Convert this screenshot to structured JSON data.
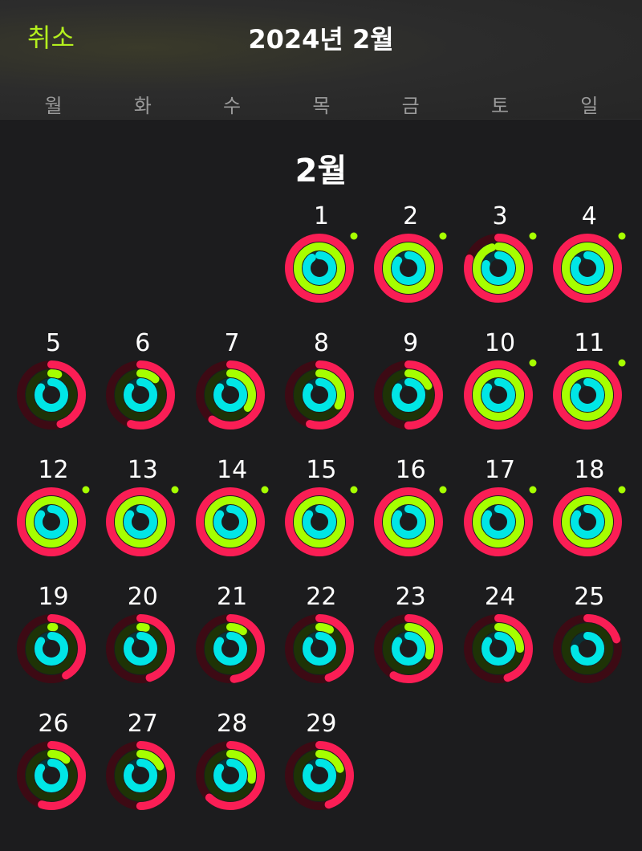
{
  "header": {
    "cancel_label": "취소",
    "title": "2024년 2월"
  },
  "weekdays": [
    "월",
    "화",
    "수",
    "목",
    "금",
    "토",
    "일"
  ],
  "month_label": "2월",
  "first_weekday_index": 3,
  "colors": {
    "accent": "#b4f01e",
    "move": "#fa1e55",
    "exercise": "#a6ff00",
    "stand": "#00e6e6",
    "goal_dot": "#a6ff00"
  },
  "days": [
    {
      "day": "1",
      "move": 1.2,
      "exercise": 1.1,
      "stand": 0.9,
      "goal": true
    },
    {
      "day": "2",
      "move": 1.15,
      "exercise": 1.1,
      "stand": 0.85,
      "goal": true
    },
    {
      "day": "3",
      "move": 0.8,
      "exercise": 0.95,
      "stand": 0.8,
      "goal": true
    },
    {
      "day": "4",
      "move": 1.3,
      "exercise": 1.2,
      "stand": 0.85,
      "goal": true
    },
    {
      "day": "5",
      "move": 0.45,
      "exercise": 0.05,
      "stand": 0.85,
      "goal": false
    },
    {
      "day": "6",
      "move": 0.55,
      "exercise": 0.12,
      "stand": 0.85,
      "goal": false
    },
    {
      "day": "7",
      "move": 0.6,
      "exercise": 0.35,
      "stand": 0.85,
      "goal": false
    },
    {
      "day": "8",
      "move": 0.55,
      "exercise": 0.33,
      "stand": 0.85,
      "goal": false
    },
    {
      "day": "9",
      "move": 0.5,
      "exercise": 0.18,
      "stand": 0.85,
      "goal": false
    },
    {
      "day": "10",
      "move": 1.1,
      "exercise": 1.1,
      "stand": 0.85,
      "goal": true
    },
    {
      "day": "11",
      "move": 1.15,
      "exercise": 1.1,
      "stand": 0.85,
      "goal": true
    },
    {
      "day": "12",
      "move": 1.3,
      "exercise": 1.2,
      "stand": 0.85,
      "goal": true
    },
    {
      "day": "13",
      "move": 1.15,
      "exercise": 1.1,
      "stand": 0.85,
      "goal": true
    },
    {
      "day": "14",
      "move": 1.1,
      "exercise": 1.05,
      "stand": 0.85,
      "goal": true
    },
    {
      "day": "15",
      "move": 1.15,
      "exercise": 1.1,
      "stand": 0.85,
      "goal": true
    },
    {
      "day": "16",
      "move": 1.1,
      "exercise": 1.05,
      "stand": 0.85,
      "goal": true
    },
    {
      "day": "17",
      "move": 1.2,
      "exercise": 1.05,
      "stand": 0.85,
      "goal": true
    },
    {
      "day": "18",
      "move": 1.25,
      "exercise": 1.2,
      "stand": 0.85,
      "goal": true
    },
    {
      "day": "19",
      "move": 0.42,
      "exercise": 0.02,
      "stand": 0.85,
      "goal": false
    },
    {
      "day": "20",
      "move": 0.45,
      "exercise": 0.04,
      "stand": 0.85,
      "goal": false
    },
    {
      "day": "21",
      "move": 0.48,
      "exercise": 0.1,
      "stand": 0.85,
      "goal": false
    },
    {
      "day": "22",
      "move": 0.45,
      "exercise": 0.08,
      "stand": 0.85,
      "goal": false
    },
    {
      "day": "23",
      "move": 0.58,
      "exercise": 0.3,
      "stand": 0.85,
      "goal": false
    },
    {
      "day": "24",
      "move": 0.45,
      "exercise": 0.25,
      "stand": 0.85,
      "goal": false
    },
    {
      "day": "25",
      "move": 0.2,
      "exercise": 0.0,
      "stand": 0.75,
      "goal": false
    },
    {
      "day": "26",
      "move": 0.55,
      "exercise": 0.12,
      "stand": 0.85,
      "goal": false
    },
    {
      "day": "27",
      "move": 0.5,
      "exercise": 0.18,
      "stand": 0.85,
      "goal": false
    },
    {
      "day": "28",
      "move": 0.62,
      "exercise": 0.28,
      "stand": 0.85,
      "goal": false
    },
    {
      "day": "29",
      "move": 0.45,
      "exercise": 0.2,
      "stand": 0.85,
      "goal": false
    }
  ]
}
